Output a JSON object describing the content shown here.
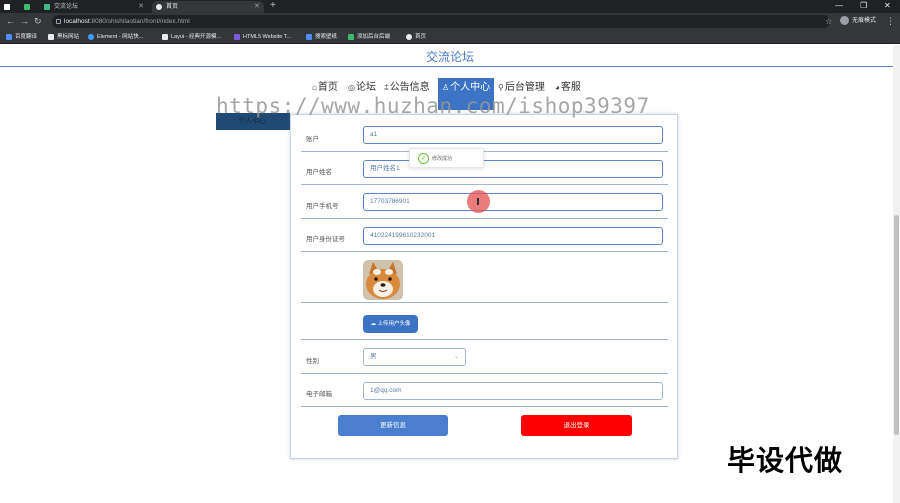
{
  "browser": {
    "tabs": [
      {
        "label": ""
      },
      {
        "label": "交流论坛"
      },
      {
        "label": "首页"
      }
    ],
    "new_tab": "+",
    "window_controls": [
      "—",
      "❐",
      "✕"
    ],
    "url_host": "localhost",
    "url_path": ":8080/shishilaotian/front/index.html",
    "profile_label": "无痕模式",
    "bookmarks": [
      "百度翻译",
      "黑标网站",
      "Element - 网站快...",
      "Layui - 经典开源模...",
      "HTML5 Website T...",
      "搜索壁纸",
      "添加后台后端",
      "首页"
    ]
  },
  "site": {
    "title": "交流论坛",
    "nav": [
      {
        "icon": "⌂",
        "label": "首页"
      },
      {
        "icon": "◎",
        "label": "论坛"
      },
      {
        "icon": "⩲",
        "label": "公告信息"
      },
      {
        "icon": "♙",
        "label": "个人中心"
      },
      {
        "icon": "⚲",
        "label": "后台管理"
      },
      {
        "icon": "◕",
        "label": "客服"
      }
    ],
    "side_tab": "个人中心"
  },
  "watermark": "https://www.huzhan.com/ishop39397",
  "form": {
    "account_label": "账户",
    "account_value": "a1",
    "name_label": "用户姓名",
    "name_value": "用户姓名1",
    "phone_label": "用户手机号",
    "phone_value": "17703786901",
    "idcard_label": "用户身份证号",
    "idcard_value": "410224199610232001",
    "upload_label": "上传用户头像",
    "gender_label": "性别",
    "gender_value": "男",
    "email_label": "电子邮箱",
    "email_value": "1@qq.com",
    "update_label": "更新信息",
    "logout_label": "退出登录"
  },
  "toast": {
    "text": "修改成功"
  },
  "promo": "毕设代做",
  "colors": {
    "primary": "#3d73c4",
    "danger": "#ff0000",
    "success": "#67c23a"
  }
}
